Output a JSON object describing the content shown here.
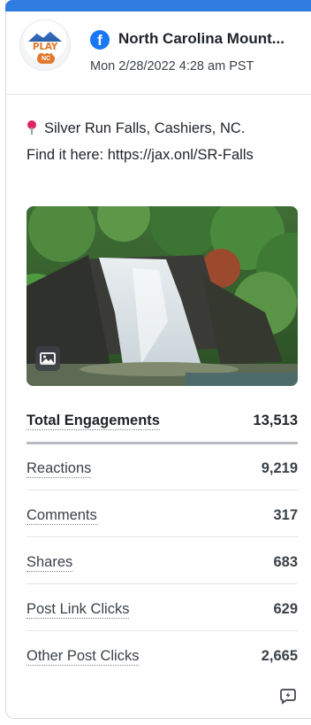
{
  "post": {
    "page_name": "North Carolina Mount...",
    "network_icon": "facebook-icon",
    "timestamp": "Mon 2/28/2022 4:28 am PST",
    "avatar": {
      "logo_text": "PLAY ON",
      "logo_badge": "NC"
    },
    "text_line_1": "Silver Run Falls, Cashiers, NC.",
    "text_line_2": "Find it here: https://jax.onl/SR-Falls",
    "image_alt_icon": "image-icon"
  },
  "metrics": [
    {
      "label": "Total Engagements",
      "value": "13,513"
    },
    {
      "label": "Reactions",
      "value": "9,219"
    },
    {
      "label": "Comments",
      "value": "317"
    },
    {
      "label": "Shares",
      "value": "683"
    },
    {
      "label": "Post Link Clicks",
      "value": "629"
    },
    {
      "label": "Other Post Clicks",
      "value": "2,665"
    }
  ],
  "colors": {
    "top_accent": "#2f7de1",
    "facebook_blue": "#1877f2",
    "logo_orange": "#e2772b"
  }
}
